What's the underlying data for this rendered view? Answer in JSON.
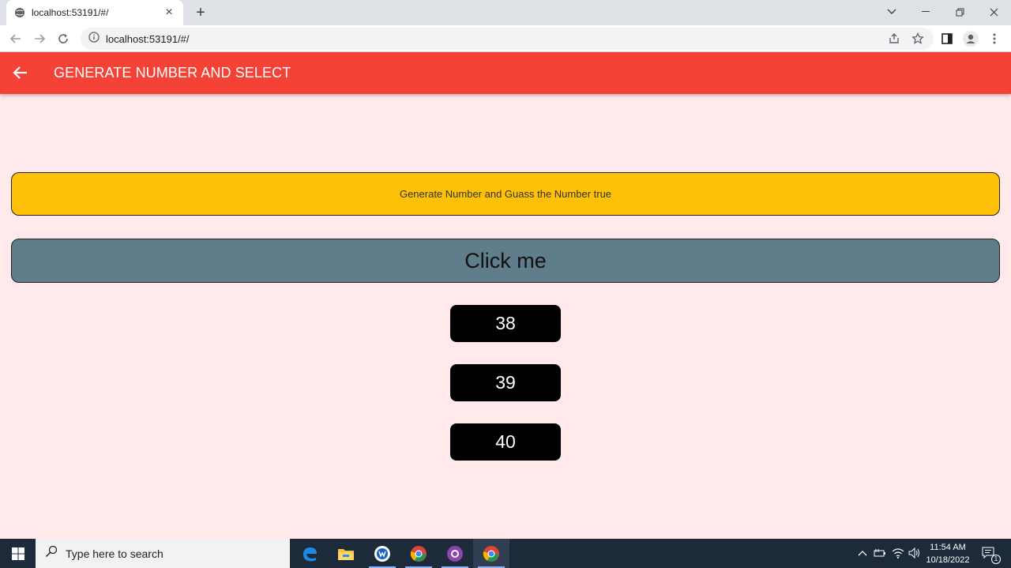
{
  "browser": {
    "tab_title": "localhost:53191/#/",
    "new_tab_label": "+",
    "address": "localhost:53191/#/"
  },
  "app": {
    "title": "GENERATE NUMBER AND SELECT",
    "banner_text": "Generate Number and Guass the Number true",
    "click_label": "Click me",
    "numbers": [
      "38",
      "39",
      "40"
    ]
  },
  "taskbar": {
    "search_placeholder": "Type here to search",
    "time": "11:54 AM",
    "date": "10/18/2022",
    "notification_count": "1"
  },
  "colors": {
    "appbar": "#f44336",
    "background": "#ffe9ea",
    "banner": "#ffc107",
    "button": "#607d8b",
    "number_button": "#000000"
  }
}
